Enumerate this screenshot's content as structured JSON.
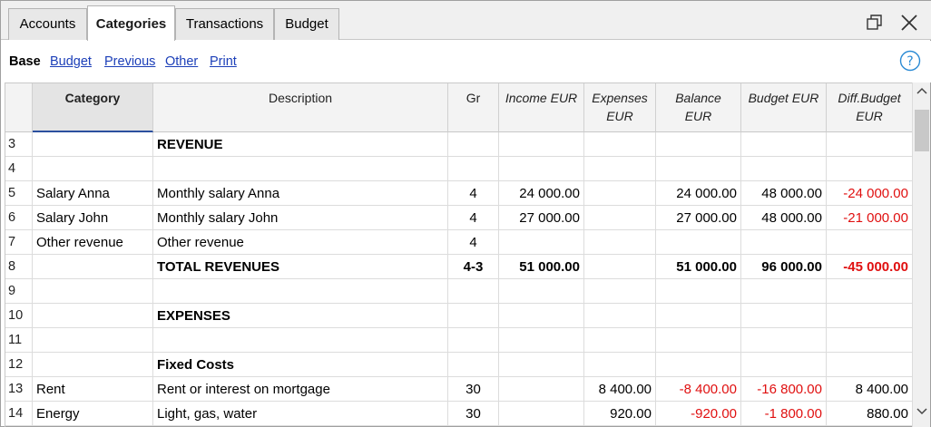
{
  "tabs": [
    {
      "label": "Accounts"
    },
    {
      "label": "Categories"
    },
    {
      "label": "Transactions"
    },
    {
      "label": "Budget"
    }
  ],
  "subnav": {
    "base": "Base",
    "links": [
      "Budget",
      "Previous",
      "Other",
      "Print"
    ]
  },
  "columns": {
    "category": "Category",
    "description": "Description",
    "gr": "Gr",
    "income": "Income EUR",
    "expenses": "Expenses EUR",
    "balance": "Balance EUR",
    "budget": "Budget EUR",
    "diff": "Diff.Budget EUR"
  },
  "rows": [
    {
      "n": "3",
      "category": "",
      "description": "REVENUE",
      "gr": "",
      "income": "",
      "expenses": "",
      "balance": "",
      "budget": "",
      "diff": ""
    },
    {
      "n": "4",
      "category": "",
      "description": "",
      "gr": "",
      "income": "",
      "expenses": "",
      "balance": "",
      "budget": "",
      "diff": ""
    },
    {
      "n": "5",
      "category": "Salary Anna",
      "description": "Monthly salary Anna",
      "gr": "4",
      "income": "24 000.00",
      "expenses": "",
      "balance": "24 000.00",
      "budget": "48 000.00",
      "diff": "-24 000.00"
    },
    {
      "n": "6",
      "category": "Salary John",
      "description": "Monthly salary John",
      "gr": "4",
      "income": "27 000.00",
      "expenses": "",
      "balance": "27 000.00",
      "budget": "48 000.00",
      "diff": "-21 000.00"
    },
    {
      "n": "7",
      "category": "Other revenue",
      "description": "Other revenue",
      "gr": "4",
      "income": "",
      "expenses": "",
      "balance": "",
      "budget": "",
      "diff": ""
    },
    {
      "n": "8",
      "category": "",
      "description": "TOTAL REVENUES",
      "gr": "4-3",
      "income": "51 000.00",
      "expenses": "",
      "balance": "51 000.00",
      "budget": "96 000.00",
      "diff": "-45 000.00"
    },
    {
      "n": "9",
      "category": "",
      "description": "",
      "gr": "",
      "income": "",
      "expenses": "",
      "balance": "",
      "budget": "",
      "diff": ""
    },
    {
      "n": "10",
      "category": "",
      "description": "EXPENSES",
      "gr": "",
      "income": "",
      "expenses": "",
      "balance": "",
      "budget": "",
      "diff": ""
    },
    {
      "n": "11",
      "category": "",
      "description": "",
      "gr": "",
      "income": "",
      "expenses": "",
      "balance": "",
      "budget": "",
      "diff": ""
    },
    {
      "n": "12",
      "category": "",
      "description": "Fixed Costs",
      "gr": "",
      "income": "",
      "expenses": "",
      "balance": "",
      "budget": "",
      "diff": ""
    },
    {
      "n": "13",
      "category": "Rent",
      "description": "Rent or interest on mortgage",
      "gr": "30",
      "income": "",
      "expenses": "8 400.00",
      "balance": "-8 400.00",
      "budget": "-16 800.00",
      "diff": "8 400.00"
    },
    {
      "n": "14",
      "category": "Energy",
      "description": "Light, gas, water",
      "gr": "30",
      "income": "",
      "expenses": "920.00",
      "balance": "-920.00",
      "budget": "-1 800.00",
      "diff": "880.00"
    }
  ],
  "colors": {
    "negative": "#e01010",
    "link": "#1c3fb8",
    "active_header_underline": "#2b4f9e"
  }
}
